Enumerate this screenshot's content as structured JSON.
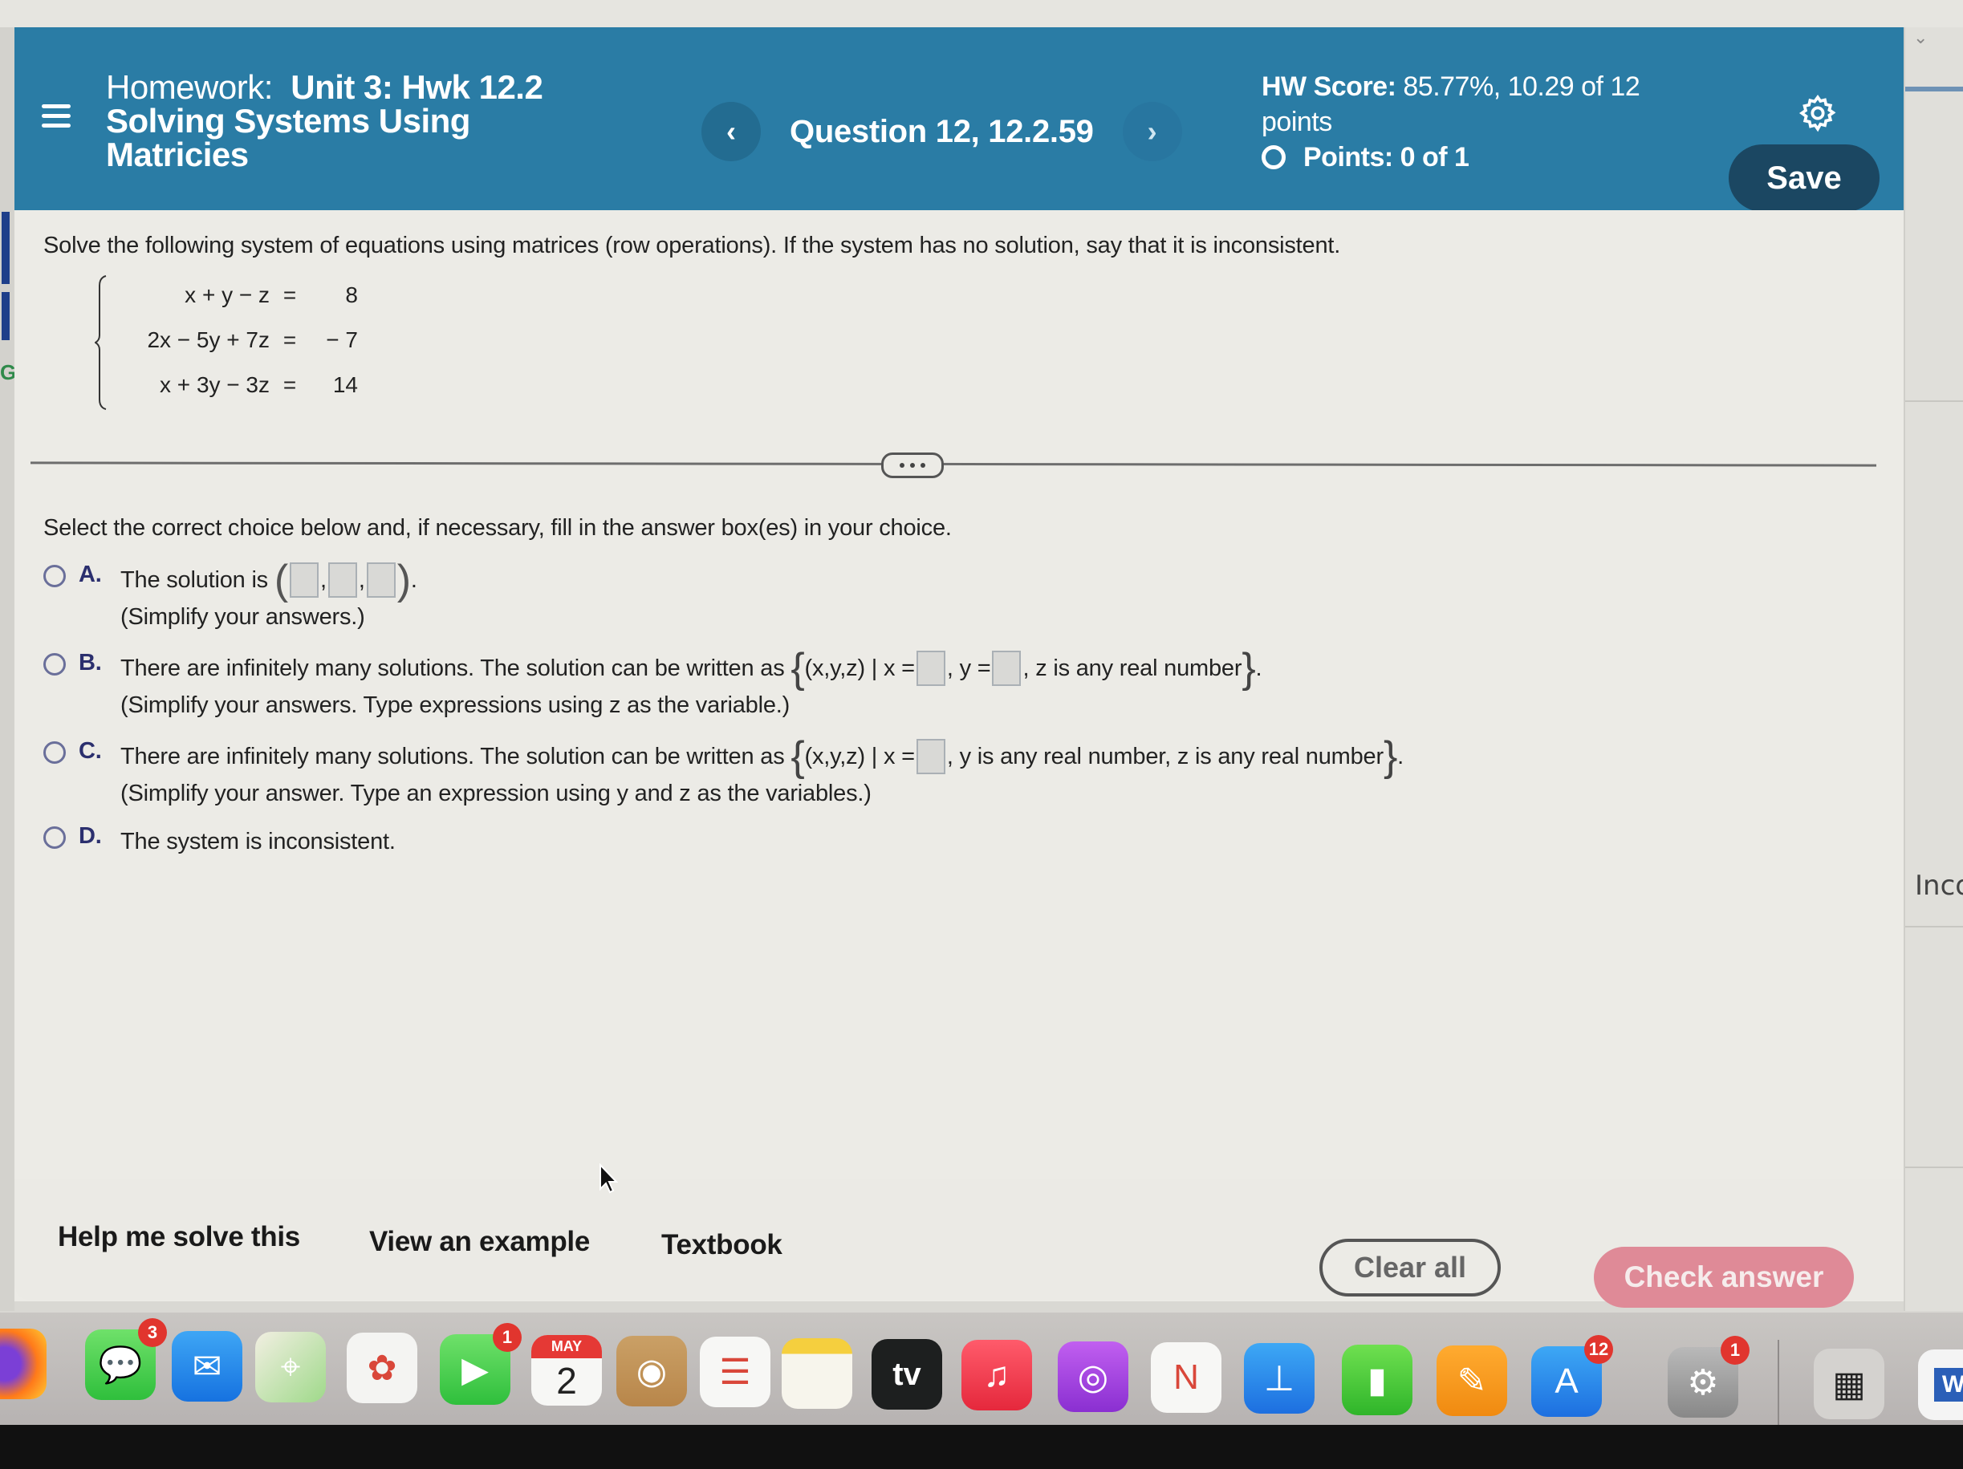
{
  "header": {
    "menu_icon": "hamburger-menu-icon",
    "title_prefix": "Homework:",
    "title_line1": "Unit 3: Hwk 12.2",
    "title_line2": "Solving Systems Using",
    "title_line3": "Matricies",
    "prev_label": "‹",
    "question_label": "Question 12, 12.2.59",
    "next_label": "›",
    "hw_score_label": "HW Score:",
    "hw_score_value": "85.77%, 10.29 of 12",
    "hw_score_unit": "points",
    "points_label": "Points: 0 of 1",
    "settings_icon": "gear-icon",
    "save_label": "Save",
    "accent_color": "#2a7ca5"
  },
  "question": {
    "prompt": "Solve the following system of equations using matrices (row operations). If the system has no solution, say that it is inconsistent.",
    "equations": [
      {
        "lhs": "x + y − z",
        "eq": "=",
        "rhs": "8"
      },
      {
        "lhs": "2x − 5y + 7z",
        "eq": "=",
        "rhs": "− 7"
      },
      {
        "lhs": "x + 3y − 3z",
        "eq": "=",
        "rhs": "14"
      }
    ],
    "expand_handle": "..."
  },
  "answer": {
    "instruction": "Select the correct choice below and, if necessary, fill in the answer box(es) in your choice.",
    "choices": [
      {
        "letter": "A.",
        "text_before": "The solution is",
        "boxes": 3,
        "hint": "(Simplify your answers.)"
      },
      {
        "letter": "B.",
        "text_before": "There are infinitely many solutions. The solution can be written as",
        "set_open": "(x,y,z) | x =",
        "mid": ", y =",
        "set_close": ", z is any real number",
        "hint": "(Simplify your answers. Type expressions using z as the variable.)"
      },
      {
        "letter": "C.",
        "text_before": "There are infinitely many solutions. The solution can be written as",
        "set_open": "(x,y,z) | x =",
        "set_close": ", y is any real number, z is any real number",
        "hint": "(Simplify your answer. Type an expression using y and z as the variables.)"
      },
      {
        "letter": "D.",
        "text_before": "The system is inconsistent."
      }
    ]
  },
  "footer": {
    "help_label": "Help me solve this",
    "example_label": "View an example",
    "textbook_label": "Textbook",
    "clear_label": "Clear all",
    "check_label": "Check answer",
    "check_color": "#df8a97"
  },
  "side_panel": {
    "partial_text": "Inco"
  },
  "dock": {
    "apps": [
      {
        "name": "firefox",
        "icon": "firefox-icon",
        "badge": ""
      },
      {
        "name": "messages",
        "icon": "messages-icon",
        "badge": "3"
      },
      {
        "name": "mail",
        "icon": "mail-icon",
        "badge": ""
      },
      {
        "name": "maps",
        "icon": "maps-icon",
        "badge": ""
      },
      {
        "name": "photos",
        "icon": "photos-icon",
        "badge": ""
      },
      {
        "name": "facetime",
        "icon": "facetime-icon",
        "badge": "1"
      },
      {
        "name": "calendar",
        "icon": "calendar-icon",
        "badge": "",
        "month": "MAY",
        "day": "2"
      },
      {
        "name": "contacts",
        "icon": "contacts-icon",
        "badge": ""
      },
      {
        "name": "reminders",
        "icon": "reminders-icon",
        "badge": ""
      },
      {
        "name": "notes",
        "icon": "notes-icon",
        "badge": ""
      },
      {
        "name": "apple-tv",
        "icon": "apple-tv-icon",
        "badge": "",
        "label": "tv"
      },
      {
        "name": "music",
        "icon": "music-icon",
        "badge": ""
      },
      {
        "name": "podcasts",
        "icon": "podcasts-icon",
        "badge": ""
      },
      {
        "name": "news",
        "icon": "news-icon",
        "badge": ""
      },
      {
        "name": "keynote",
        "icon": "keynote-icon",
        "badge": ""
      },
      {
        "name": "numbers",
        "icon": "numbers-icon",
        "badge": ""
      },
      {
        "name": "pages",
        "icon": "pages-icon",
        "badge": ""
      },
      {
        "name": "app-store",
        "icon": "app-store-icon",
        "badge": "12"
      },
      {
        "name": "system-settings",
        "icon": "system-settings-icon",
        "badge": "1"
      },
      {
        "name": "calculator",
        "icon": "calculator-icon",
        "badge": ""
      },
      {
        "name": "word",
        "icon": "word-icon",
        "badge": "",
        "label": "W"
      }
    ]
  }
}
